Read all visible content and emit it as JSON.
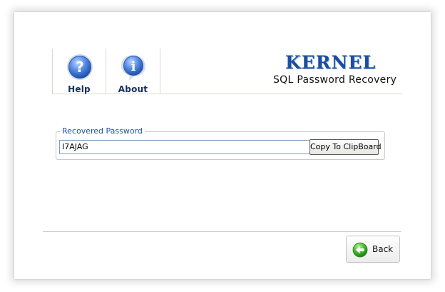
{
  "toolbar": {
    "help_label": "Help",
    "about_label": "About"
  },
  "brand": {
    "logo_text": "KERNEL",
    "product_name": "SQL Password Recovery"
  },
  "recovered": {
    "group_label": "Recovered Password",
    "password_value": "I7AJAG",
    "copy_label": "Copy To ClipBoard"
  },
  "footer": {
    "back_label": "Back"
  },
  "colors": {
    "accent_blue": "#1a4ea2",
    "label_blue": "#1f4fa6",
    "back_green": "#2f9e1f"
  },
  "icons": {
    "help": "help-icon",
    "about": "info-icon",
    "back": "back-arrow-icon"
  }
}
